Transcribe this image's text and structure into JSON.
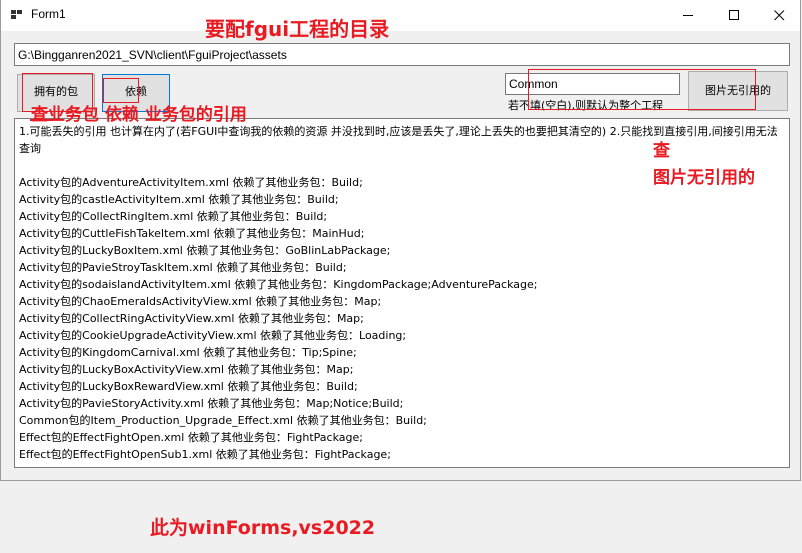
{
  "window": {
    "title": "Form1",
    "controls": {
      "minimize": "minimize-icon",
      "maximize": "maximize-icon",
      "close": "close-icon"
    }
  },
  "path_input": {
    "value": "G:\\Bingganren2021_SVN\\client\\FguiProject\\assets"
  },
  "buttons": {
    "owned_packages": "拥有的包",
    "dependencies": "依赖",
    "unused_images": "图片无引用的"
  },
  "common_input": {
    "value": "Common"
  },
  "hint": "若不填(空白),则默认为整个工程",
  "output": {
    "intro": "1.可能丢失的引用 也计算在内了(若FGUI中查询我的依赖的资源 并没找到时,应该是丢失了,理论上丢失的也要把其清空的)  2.只能找到直接引用,间接引用无法查询",
    "lines": [
      "Activity包的AdventureActivityItem.xml 依赖了其他业务包：Build;",
      "Activity包的castleActivityItem.xml 依赖了其他业务包：Build;",
      "Activity包的CollectRingItem.xml 依赖了其他业务包：Build;",
      "Activity包的CuttleFishTakeItem.xml 依赖了其他业务包：MainHud;",
      "Activity包的LuckyBoxItem.xml 依赖了其他业务包：GoBlinLabPackage;",
      "Activity包的PavieStroyTaskItem.xml 依赖了其他业务包：Build;",
      "Activity包的sodaislandActivityItem.xml 依赖了其他业务包：KingdomPackage;AdventurePackage;",
      "Activity包的ChaoEmeraldsActivityView.xml 依赖了其他业务包：Map;",
      "Activity包的CollectRingActivityView.xml 依赖了其他业务包：Map;",
      "Activity包的CookieUpgradeActivityView.xml 依赖了其他业务包：Loading;",
      "Activity包的KingdomCarnival.xml 依赖了其他业务包：Tip;Spine;",
      "Activity包的LuckyBoxActivityView.xml 依赖了其他业务包：Map;",
      "Activity包的LuckyBoxRewardView.xml 依赖了其他业务包：Build;",
      "Activity包的PavieStoryActivity.xml 依赖了其他业务包：Map;Notice;Build;",
      "Common包的Item_Production_Upgrade_Effect.xml 依赖了其他业务包：Build;",
      "Effect包的EffectFightOpen.xml 依赖了其他业务包：FightPackage;",
      "Effect包的EffectFightOpenSub1.xml 依赖了其他业务包：FightPackage;"
    ]
  },
  "annotations": {
    "directory": "要配fgui工程的目录",
    "function": "查业务包 依赖 业务包的引用",
    "find": "查",
    "unused": "图片无引用的",
    "footer": "此为winForms,vs2022"
  },
  "colors": {
    "annotation": "#e81b23",
    "focus_border": "#0078d7"
  }
}
